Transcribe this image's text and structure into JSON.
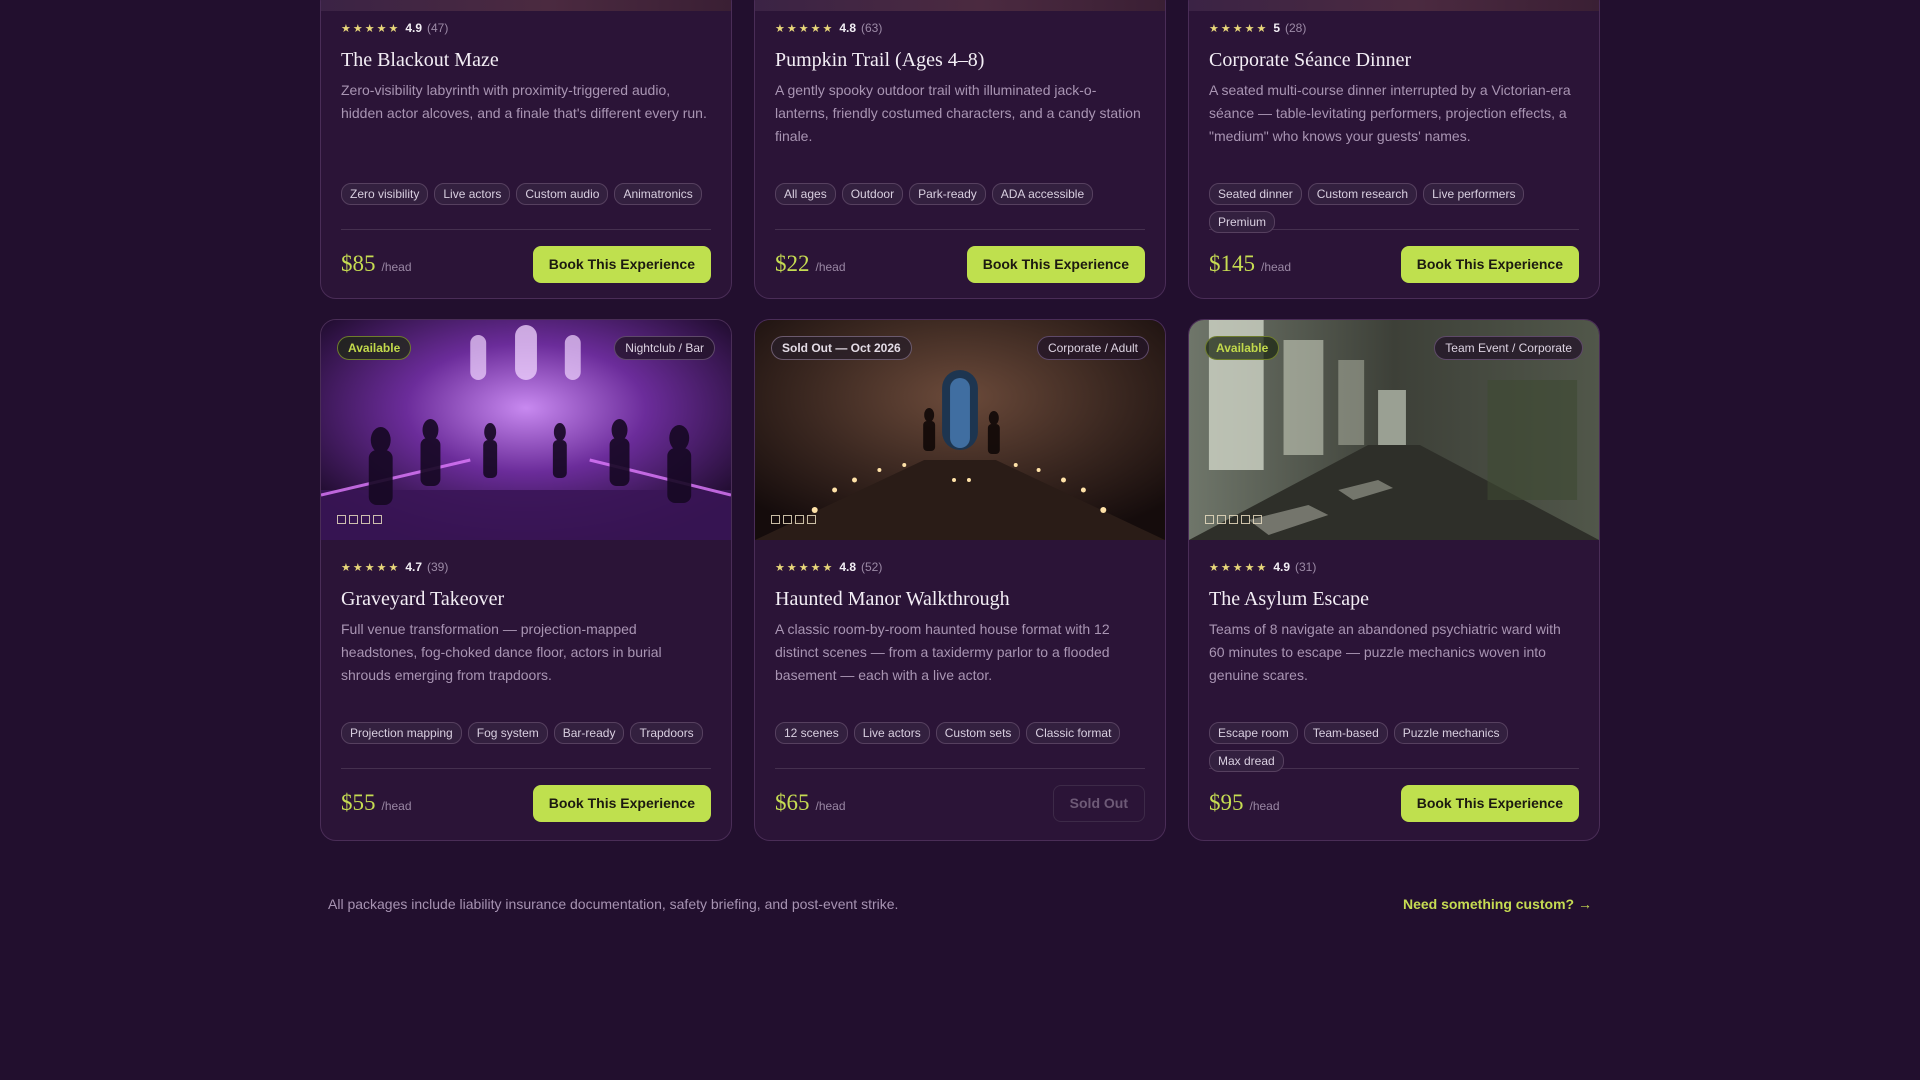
{
  "cards": [
    {
      "title": "The Blackout Maze",
      "score": "4.9",
      "count": "(47)",
      "desc": "Zero-visibility labyrinth with proximity-triggered audio, hidden actor alcoves, and a finale that's different every run.",
      "tags": [
        "Zero visibility",
        "Live actors",
        "Custom audio",
        "Animatronics"
      ],
      "price": "$85",
      "unit": "/head",
      "cta": "Book This Experience"
    },
    {
      "title": "Pumpkin Trail (Ages 4–8)",
      "score": "4.8",
      "count": "(63)",
      "desc": "A gently spooky outdoor trail with illuminated jack-o-lanterns, friendly costumed characters, and a candy station finale.",
      "tags": [
        "All ages",
        "Outdoor",
        "Park-ready",
        "ADA accessible"
      ],
      "price": "$22",
      "unit": "/head",
      "cta": "Book This Experience"
    },
    {
      "title": "Corporate Séance Dinner",
      "score": "5",
      "count": "(28)",
      "desc": "A seated multi-course dinner interrupted by a Victorian-era séance — table-levitating performers, projection effects, a \"medium\" who knows your guests' names.",
      "tags": [
        "Seated dinner",
        "Custom research",
        "Live performers",
        "Premium"
      ],
      "price": "$145",
      "unit": "/head",
      "cta": "Book This Experience"
    },
    {
      "title": "Graveyard Takeover",
      "score": "4.7",
      "count": "(39)",
      "status": "Available",
      "category": "Nightclub / Bar",
      "desc": "Full venue transformation — projection-mapped headstones, fog-choked dance floor, actors in burial shrouds emerging from trapdoors.",
      "tags": [
        "Projection mapping",
        "Fog system",
        "Bar-ready",
        "Trapdoors"
      ],
      "price": "$55",
      "unit": "/head",
      "cta": "Book This Experience"
    },
    {
      "title": "Haunted Manor Walkthrough",
      "score": "4.8",
      "count": "(52)",
      "status": "Sold Out — Oct 2026",
      "category": "Corporate / Adult",
      "desc": "A classic room-by-room haunted house format with 12 distinct scenes — from a taxidermy parlor to a flooded basement — each with a live actor.",
      "tags": [
        "12 scenes",
        "Live actors",
        "Custom sets",
        "Classic format"
      ],
      "price": "$65",
      "unit": "/head",
      "cta": "Sold Out"
    },
    {
      "title": "The Asylum Escape",
      "score": "4.9",
      "count": "(31)",
      "status": "Available",
      "category": "Team Event / Corporate",
      "desc": "Teams of 8 navigate an abandoned psychiatric ward with 60 minutes to escape — puzzle mechanics woven into genuine scares.",
      "tags": [
        "Escape room",
        "Team-based",
        "Puzzle mechanics",
        "Max dread"
      ],
      "price": "$95",
      "unit": "/head",
      "cta": "Book This Experience"
    }
  ],
  "stars": "★★★★★",
  "note": "All packages include liability insurance documentation, safety briefing, and post-event strike.",
  "custom_link": "Need something custom? →",
  "colors": {
    "background": "#220f2e",
    "card": "#2b1437",
    "accent": "#bfe04e",
    "price": "#c6dc52"
  }
}
